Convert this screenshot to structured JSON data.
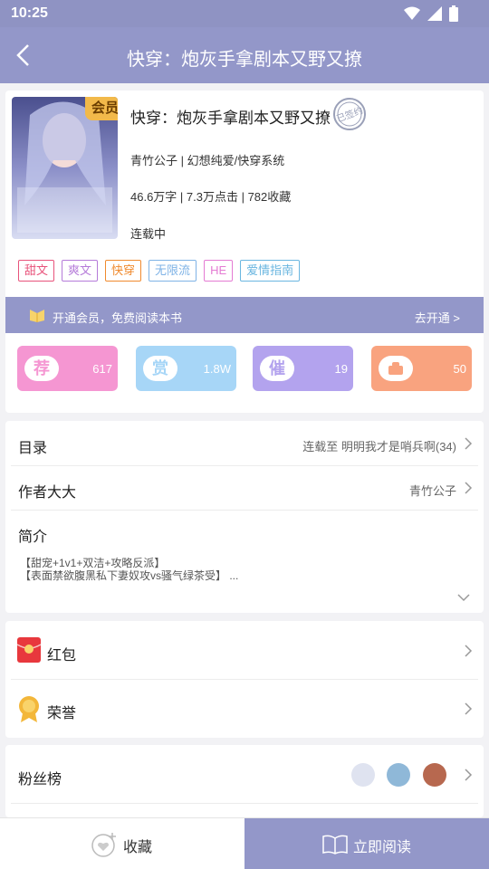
{
  "status": {
    "time": "10:25"
  },
  "header": {
    "title": "快穿：炮灰手拿剧本又野又撩"
  },
  "book": {
    "vip_badge": "会员",
    "title": "快穿：炮灰手拿剧本又野又撩",
    "stamp": "已签约",
    "author_genre": "青竹公子 | 幻想纯爱/快穿系统",
    "stats": "46.6万字 | 7.3万点击 | 782收藏",
    "status": "连载中",
    "cover_text": "快穿：炮灰手拿剧本又野又撩",
    "tags": [
      {
        "label": "甜文",
        "color": "#e8537b"
      },
      {
        "label": "爽文",
        "color": "#b57bd9"
      },
      {
        "label": "快穿",
        "color": "#f08a2e"
      },
      {
        "label": "无限流",
        "color": "#7fb3e6"
      },
      {
        "label": "HE",
        "color": "#e47bd3"
      },
      {
        "label": "爱情指南",
        "color": "#6ab6e0"
      }
    ]
  },
  "vip_bar": {
    "label": "开通会员，免费阅读本书",
    "action": "去开通 >"
  },
  "actions": [
    {
      "icon_text": "荐",
      "count": "617",
      "color": "#f596d2",
      "icon_name": "recommend-icon"
    },
    {
      "icon_text": "赏",
      "count": "1.8W",
      "color": "#a7d6f7",
      "icon_name": "reward-icon"
    },
    {
      "icon_text": "催",
      "count": "19",
      "color": "#b3a3ee",
      "icon_name": "urge-icon"
    },
    {
      "icon_text": "",
      "count": "50",
      "color": "#f9a37f",
      "icon_name": "gift-icon"
    }
  ],
  "toc": {
    "label": "目录",
    "value": "连载至 明明我才是哨兵啊(34)"
  },
  "author": {
    "label": "作者大大",
    "value": "青竹公子"
  },
  "intro": {
    "label": "简介",
    "line1": "【甜宠+1v1+双洁+攻略反派】",
    "line2": "【表面禁欲腹黑私下妻奴攻vs骚气绿茶受】 ..."
  },
  "red_packet": {
    "label": "红包"
  },
  "honor": {
    "label": "荣誉"
  },
  "fans": {
    "label": "粉丝榜"
  },
  "bottom": {
    "favorite": "收藏",
    "read": "立即阅读"
  },
  "colors": {
    "accent": "#9397c9",
    "vip_gold": "#f2b94a"
  }
}
